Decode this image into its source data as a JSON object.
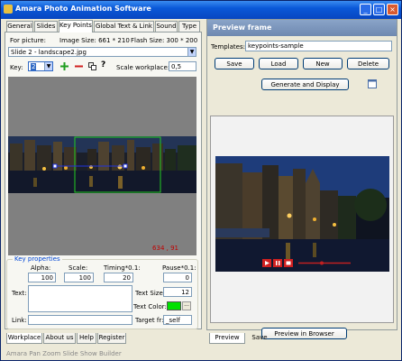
{
  "window": {
    "title": "Amara Photo Animation Software"
  },
  "left_tabs": [
    "General",
    "Slides",
    "Key Points",
    "Global Text & Link",
    "Sound",
    "Type"
  ],
  "for_picture": {
    "label": "For picture:",
    "image_size_label": "Image Size: 661 * 210",
    "flash_size_label": "Flash Size: 300 * 200",
    "slide_value": "Slide 2 - landscape2.jpg"
  },
  "key": {
    "label": "Key:",
    "value": "2",
    "scale_label": "Scale workplace:",
    "scale_value": "0,5"
  },
  "workarea": {
    "coords": "634 , 91"
  },
  "key_properties": {
    "legend": "Key properties",
    "alpha_label": "Alpha:",
    "alpha_value": "100",
    "scale_label": "Scale:",
    "scale_value": "100",
    "timing_label": "Timing*0.1:",
    "timing_value": "20",
    "pause_label": "Pause*0.1:",
    "pause_value": "0",
    "text_label": "Text:",
    "text_value": "",
    "text_size_label": "Text Size:",
    "text_size_value": "12",
    "text_color_label": "Text Color:",
    "text_color": "#00E000",
    "link_label": "Link:",
    "link_value": "",
    "target_label": "Target fr:",
    "target_value": "_self"
  },
  "left_bottom_tabs": [
    "Workplace",
    "About us",
    "Help",
    "Register"
  ],
  "preview_frame": {
    "title": "Preview frame",
    "templates_label": "Templates:",
    "templates_value": "keypoints-sample",
    "buttons": [
      "Save",
      "Load",
      "New",
      "Delete"
    ],
    "generate_label": "Generate and Display",
    "preview_browser_label": "Preview in Browser"
  },
  "right_bottom_tabs": [
    "Preview",
    "Save"
  ],
  "status": "Amara Pan Zoom Slide Show Builder"
}
